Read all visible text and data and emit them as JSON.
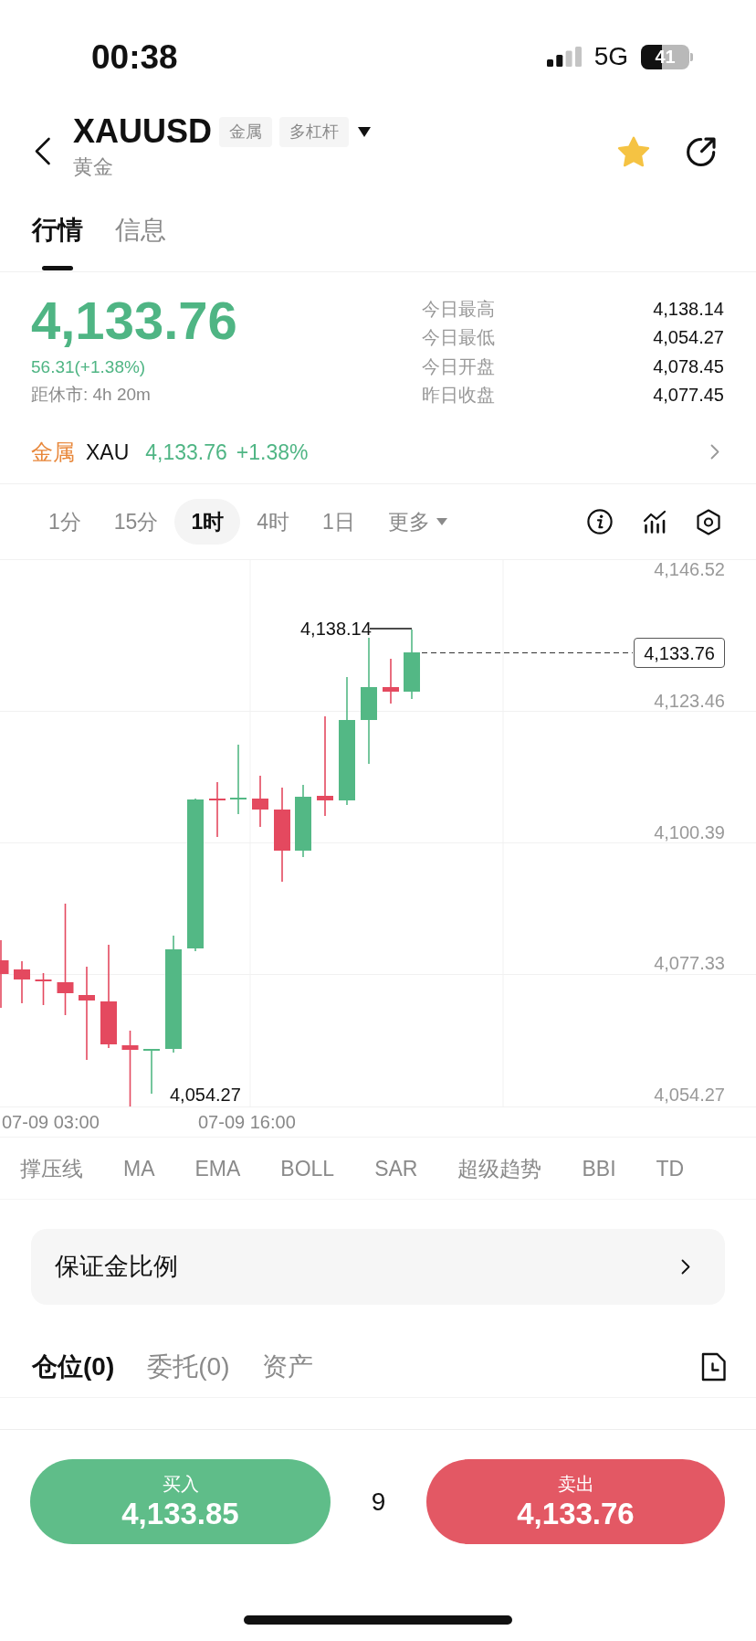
{
  "status_bar": {
    "time": "00:38",
    "network": "5G",
    "battery": "41"
  },
  "header": {
    "symbol": "XAUUSD",
    "tags": [
      "金属",
      "多杠杆"
    ],
    "name": "黄金",
    "favorited": true
  },
  "tabs": [
    {
      "label": "行情",
      "selected": true
    },
    {
      "label": "信息",
      "selected": false
    }
  ],
  "quote": {
    "price": "4,133.76",
    "change": "56.31(+1.38%)",
    "countdown": "距休市: 4h 20m",
    "stats": [
      {
        "label": "今日最高",
        "value": "4,138.14"
      },
      {
        "label": "今日最低",
        "value": "4,054.27"
      },
      {
        "label": "今日开盘",
        "value": "4,078.45"
      },
      {
        "label": "昨日收盘",
        "value": "4,077.45"
      }
    ]
  },
  "related_market": {
    "category": "金属",
    "symbol": "XAU",
    "price": "4,133.76",
    "change": "+1.38%"
  },
  "intervals": [
    {
      "label": "1分",
      "kind": "interval",
      "selected": false
    },
    {
      "label": "15分",
      "kind": "interval",
      "selected": false
    },
    {
      "label": "1时",
      "kind": "interval",
      "selected": true
    },
    {
      "label": "4时",
      "kind": "interval",
      "selected": false
    },
    {
      "label": "1日",
      "kind": "interval",
      "selected": false
    },
    {
      "label": "更多",
      "kind": "menu",
      "selected": false
    }
  ],
  "chart": {
    "y_axis_labels": [
      "4,146.52",
      "4,123.46",
      "4,100.39",
      "4,077.33",
      "4,054.27"
    ],
    "x_axis_labels": [
      "07-09 03:00",
      "07-09 16:00"
    ],
    "high_label": "4,138.14",
    "low_label": "4,054.27",
    "last_price_tag": "4,133.76"
  },
  "indicators": [
    "撑压线",
    "MA",
    "EMA",
    "BOLL",
    "SAR",
    "超级趋势",
    "BBI",
    "TD"
  ],
  "margin_ratio": "保证金比例",
  "position_tabs": [
    {
      "label": "仓位(0)",
      "selected": true
    },
    {
      "label": "委托(0)",
      "selected": false
    },
    {
      "label": "资产",
      "selected": false
    }
  ],
  "trade_bar": {
    "buy": {
      "label": "买入",
      "price": "4,133.85"
    },
    "spread": "9",
    "sell": {
      "label": "卖出",
      "price": "4,133.76"
    }
  }
}
